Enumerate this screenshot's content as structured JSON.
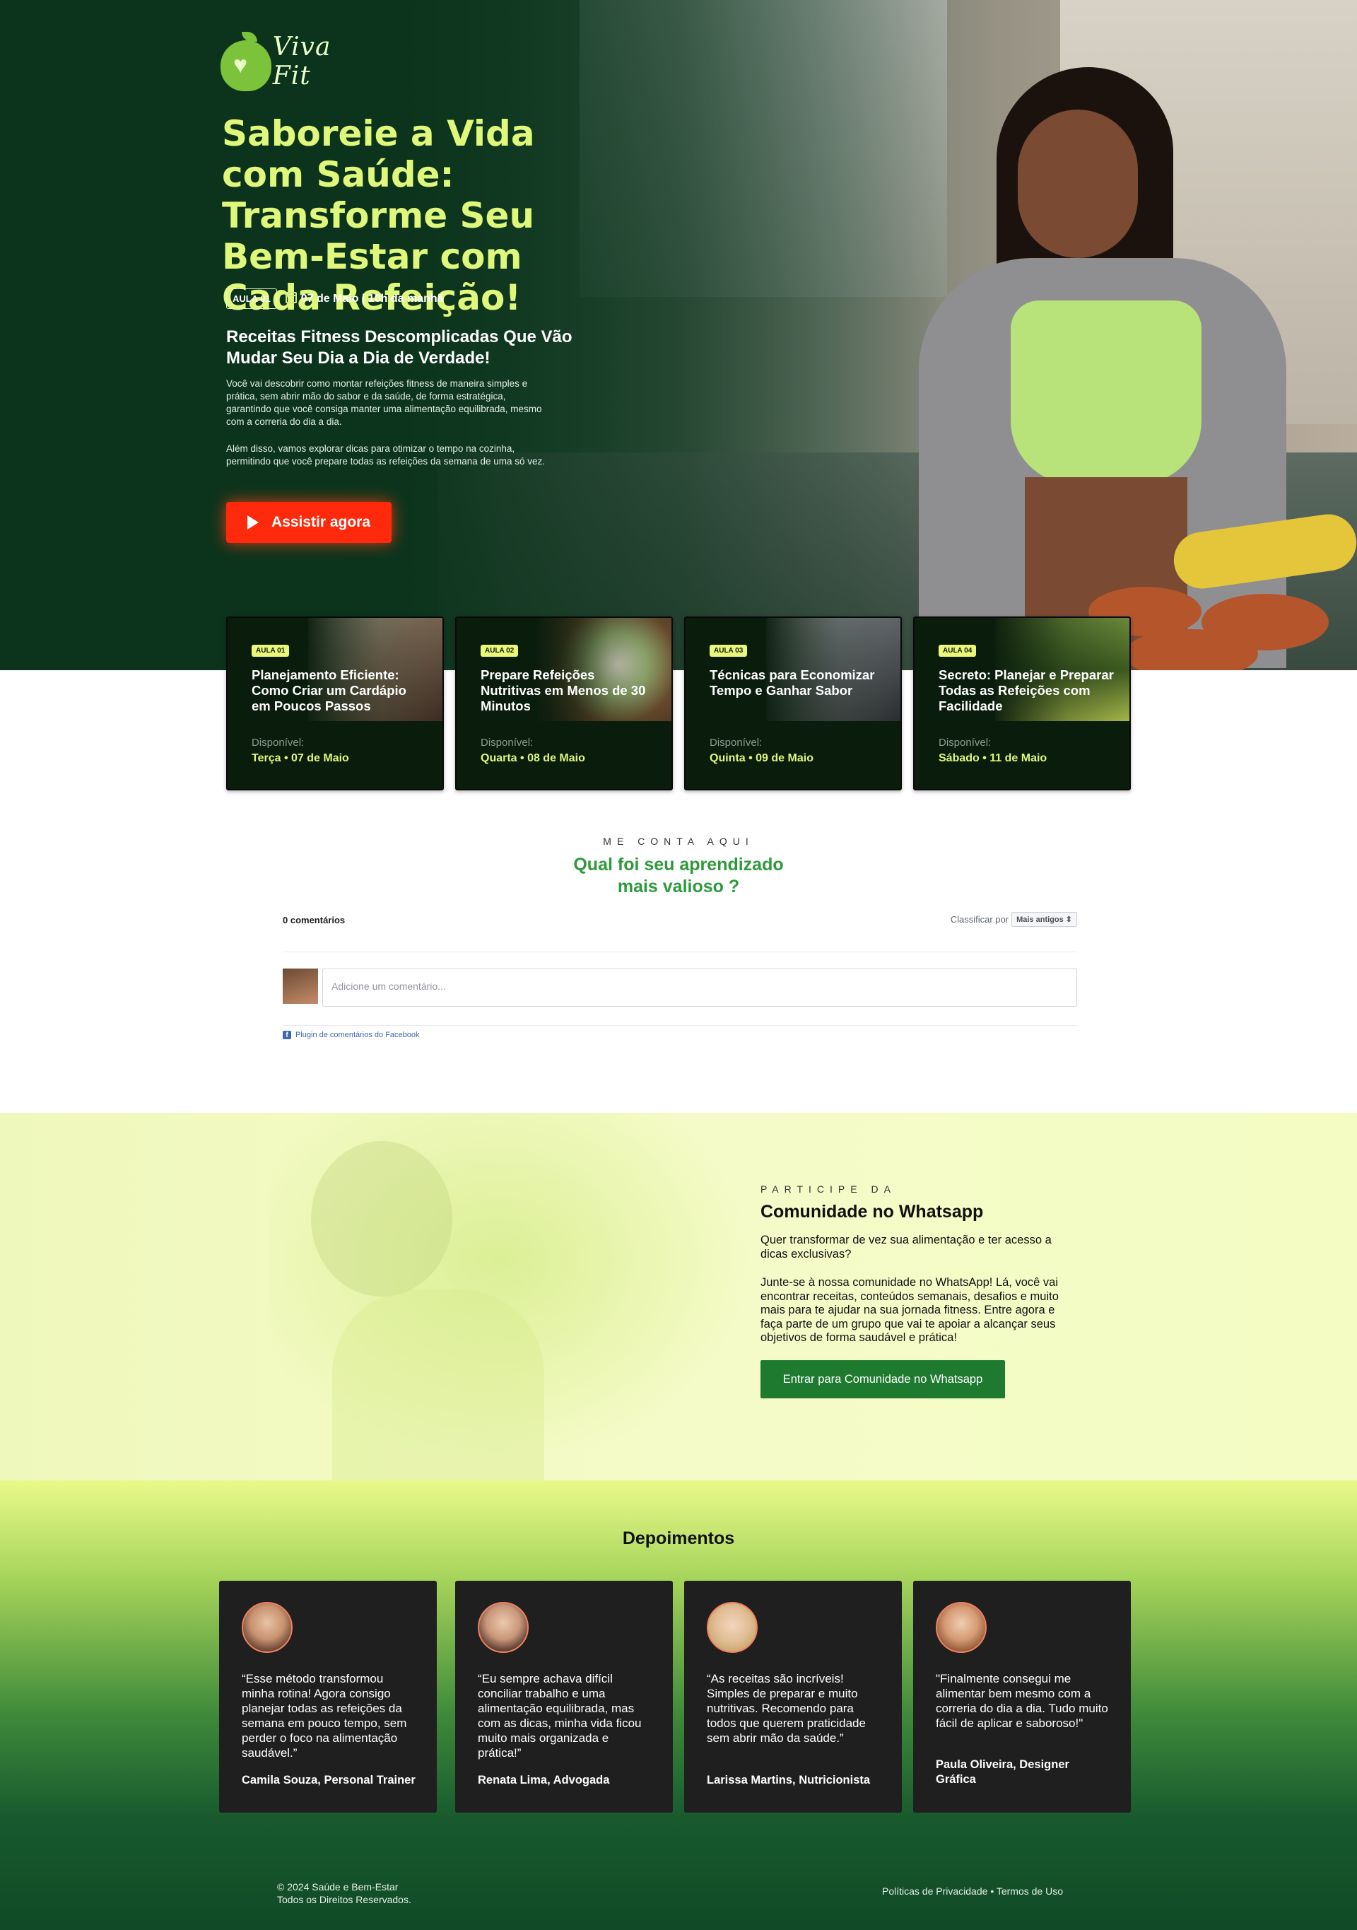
{
  "brand": {
    "logo_text": "Viva Fit"
  },
  "hero": {
    "title": "Saboreie a Vida com Saúde: Transforme Seu Bem-Estar com Cada Refeição!",
    "badge": "AULA 01",
    "date_time": "07 de Maio | 10h da manhã",
    "subtitle": "Receitas Fitness Descomplicadas Que Vão Mudar Seu Dia a Dia de Verdade!",
    "paragraph1": "Você vai descobrir como montar refeições fitness de maneira simples e prática, sem abrir mão do sabor e da saúde, de forma estratégica, garantindo que você consiga manter uma alimentação equilibrada, mesmo com a correria do dia a dia.",
    "paragraph2": "Além disso, vamos explorar dicas para otimizar o tempo na cozinha, permitindo que você prepare todas as refeições da semana de uma só vez.",
    "cta_label": "Assistir agora",
    "cta_color": "#ff2a0c"
  },
  "lessons": [
    {
      "badge": "AULA 01",
      "title": "Planejamento Eficiente: Como Criar um Cardápio em Poucos Passos",
      "available_label": "Disponível:",
      "date": "Terça • 07 de Maio"
    },
    {
      "badge": "AULA 02",
      "title": "Prepare Refeições Nutritivas em Menos de 30 Minutos",
      "available_label": "Disponível:",
      "date": "Quarta • 08 de Maio"
    },
    {
      "badge": "AULA 03",
      "title": "Técnicas para Economizar Tempo e Ganhar Sabor",
      "available_label": "Disponível:",
      "date": "Quinta • 09 de Maio"
    },
    {
      "badge": "AULA 04",
      "title": "Secreto: Planejar e Preparar Todas as Refeições com Facilidade",
      "available_label": "Disponível:",
      "date": "Sábado • 11 de Maio"
    }
  ],
  "comments": {
    "kicker": "ME CONTA AQUI",
    "title_line1": "Qual foi seu aprendizado",
    "title_line2": "mais valioso ?",
    "count": "0 comentários",
    "sort_label": "Classificar por",
    "sort_value": "Mais antigos ⇕",
    "placeholder": "Adicione um comentário...",
    "plugin_label": "Plugin de comentários do Facebook"
  },
  "community": {
    "kicker": "PARTICIPE DA",
    "title": "Comunidade no Whatsapp",
    "p1": "Quer transformar de vez sua alimentação e ter acesso a dicas exclusivas?",
    "p2": "Junte-se à nossa comunidade no WhatsApp! Lá, você vai encontrar receitas, conteúdos semanais, desafios e muito mais para te ajudar na sua jornada fitness. Entre agora e faça parte de um grupo que vai te apoiar a alcançar seus objetivos de forma saudável e prática!",
    "button_label": "Entrar para Comunidade no Whatsapp",
    "button_color": "#1d7a2f"
  },
  "testimonials": {
    "title": "Depoimentos",
    "items": [
      {
        "quote": "“Esse método transformou minha rotina! Agora consigo planejar todas as refeições da semana em pouco tempo, sem perder o foco na alimentação saudável.”",
        "author": "Camila Souza, Personal Trainer"
      },
      {
        "quote": "“Eu sempre achava difícil conciliar trabalho e uma alimentação equilibrada, mas com as dicas, minha vida ficou muito mais organizada e prática!”",
        "author": "Renata Lima, Advogada"
      },
      {
        "quote": "“As receitas são incríveis! Simples de preparar e muito nutritivas. Recomendo para todos que querem praticidade sem abrir mão da saúde.”",
        "author": "Larissa Martins, Nutricionista"
      },
      {
        "quote": "\"Finalmente consegui me alimentar bem mesmo com a correria do dia a dia. Tudo muito fácil de aplicar e saboroso!\"",
        "author": "Paula Oliveira, Designer Gráfica"
      }
    ]
  },
  "footer": {
    "copyright": "© 2024 Saúde e Bem-Estar",
    "rights": "Todos os Direitos Reservados.",
    "privacy": "Políticas de Privacidade",
    "separator": "•",
    "terms": "Termos de Uso"
  }
}
